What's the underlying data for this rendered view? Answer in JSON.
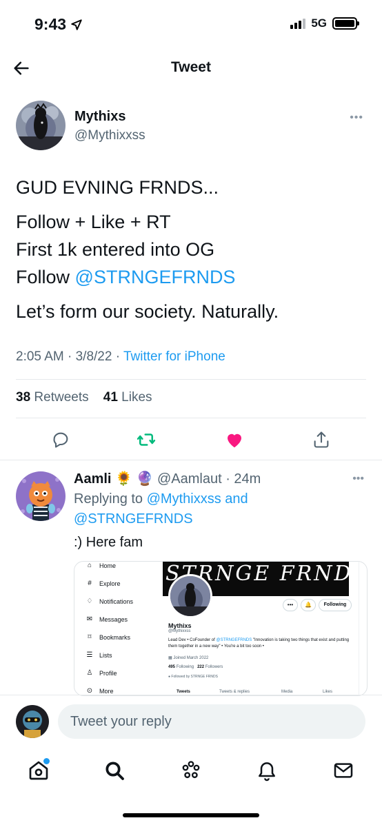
{
  "status_bar": {
    "time": "9:43",
    "network": "5G"
  },
  "header": {
    "title": "Tweet"
  },
  "tweet": {
    "author": {
      "name": "Mythixs",
      "handle": "@Mythixxss"
    },
    "lines": {
      "l1": "GUD EVNING FRNDS...",
      "l2": "Follow + Like + RT",
      "l3": "First 1k entered into OG",
      "l4_prefix": "Follow ",
      "l4_mention": "@STRNGEFRNDS",
      "l5": "Let’s form our society. Naturally."
    },
    "time": "2:05 AM",
    "date": "3/8/22",
    "source": "Twitter for iPhone",
    "retweets_count": "38",
    "retweets_label": "Retweets",
    "likes_count": "41",
    "likes_label": "Likes",
    "liked": true
  },
  "reply": {
    "name": "Aamli",
    "emoji": "🌻 🔮",
    "handle": "@Aamlaut",
    "time": "24m",
    "replying_prefix": "Replying to ",
    "replying_user1": "@Mythixxss",
    "replying_and": " and",
    "replying_user2": "@STRNGEFRNDS",
    "text": ":) Here fam",
    "media": {
      "nav": [
        "Home",
        "Explore",
        "Notifications",
        "Messages",
        "Bookmarks",
        "Lists",
        "Profile",
        "More"
      ],
      "banner_text": "STRNGE FRNDS",
      "follow_button": "Following",
      "profile_name": "Mythixs",
      "profile_handle": "@Mythixxss",
      "bio_prefix": "Lead Dev • CoFounder of ",
      "bio_mention": "@STRNGEFRNDS",
      "bio_suffix": " \"Innovation is taking two things that exist and putting them together in a new way\" • You're a bit too soon •",
      "joined": "Joined March 2022",
      "following_count": "495",
      "following_label": "Following",
      "followers_count": "222",
      "followers_label": "Followers",
      "followed_by": "Followed by STRNGE FRNDS",
      "tabs": [
        "Tweets",
        "Tweets & replies",
        "Media",
        "Likes"
      ]
    }
  },
  "composer": {
    "placeholder": "Tweet your reply"
  },
  "tabs": [
    "home-icon",
    "search-icon",
    "spaces-icon",
    "notifications-icon",
    "messages-icon"
  ],
  "colors": {
    "accent": "#1d9bf0",
    "like": "#f91880",
    "retweet": "#00ba7c",
    "secondary_text": "#536471"
  }
}
